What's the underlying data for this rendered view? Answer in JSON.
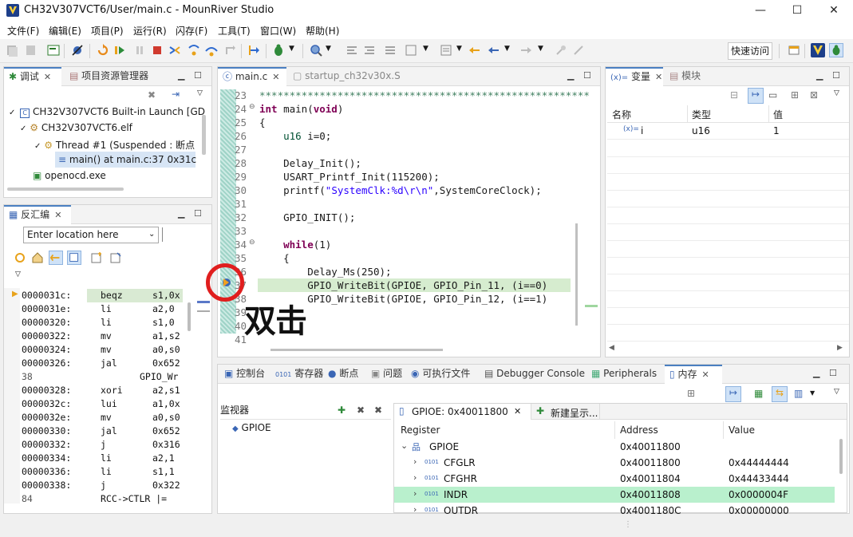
{
  "window": {
    "title": "CH32V307VCT6/User/main.c - MounRiver Studio",
    "minimize": "—",
    "maximize": "☐",
    "close": "✕"
  },
  "menu": [
    "文件(F)",
    "编辑(E)",
    "项目(P)",
    "运行(R)",
    "闪存(F)",
    "工具(T)",
    "窗口(W)",
    "帮助(H)"
  ],
  "toolbar": {
    "quick_access": "快速访问"
  },
  "debug_view": {
    "tab_debug": "调试",
    "tab_project": "项目资源管理器",
    "tree": [
      "CH32V307VCT6 Built-in Launch [GD",
      "CH32V307VCT6.elf",
      "Thread #1 (Suspended : 断点",
      "main() at main.c:37 0x31c",
      "openocd.exe"
    ]
  },
  "disasm_view": {
    "tab": "反汇编",
    "location_placeholder": "Enter location here",
    "rows": [
      {
        "addr": "0000031c:",
        "op": "beqz",
        "args": "s1,0x"
      },
      {
        "addr": "0000031e:",
        "op": "li",
        "args": "a2,0"
      },
      {
        "addr": "00000320:",
        "op": "li",
        "args": "s1,0"
      },
      {
        "addr": "00000322:",
        "op": "mv",
        "args": "a1,s2"
      },
      {
        "addr": "00000324:",
        "op": "mv",
        "args": "a0,s0"
      },
      {
        "addr": "00000326:",
        "op": "jal",
        "args": "0x652"
      },
      {
        "addr": "38",
        "op": "",
        "args": "GPIO_Wr"
      },
      {
        "addr": "00000328:",
        "op": "xori",
        "args": "a2,s1"
      },
      {
        "addr": "0000032c:",
        "op": "lui",
        "args": "a1,0x"
      },
      {
        "addr": "0000032e:",
        "op": "mv",
        "args": "a0,s0"
      },
      {
        "addr": "00000330:",
        "op": "jal",
        "args": "0x652"
      },
      {
        "addr": "00000332:",
        "op": "j",
        "args": "0x316"
      },
      {
        "addr": "00000334:",
        "op": "li",
        "args": "a2,1"
      },
      {
        "addr": "00000336:",
        "op": "li",
        "args": "s1,1"
      },
      {
        "addr": "00000338:",
        "op": "j",
        "args": "0x322"
      },
      {
        "addr": "84",
        "op": "RCC->CTLR |=",
        "args": ""
      }
    ]
  },
  "editor": {
    "tab_main": "main.c",
    "tab_startup": "startup_ch32v30x.S",
    "lines": [
      {
        "n": "23",
        "t": "*******************************************************"
      },
      {
        "n": "24",
        "t": "int main(void)"
      },
      {
        "n": "25",
        "t": "{"
      },
      {
        "n": "26",
        "t": "    u16 i=0;"
      },
      {
        "n": "27",
        "t": ""
      },
      {
        "n": "28",
        "t": "    Delay_Init();"
      },
      {
        "n": "29",
        "t": "    USART_Printf_Init(115200);"
      },
      {
        "n": "30",
        "t": "    printf(\"SystemClk:%d\\r\\n\",SystemCoreClock);"
      },
      {
        "n": "31",
        "t": ""
      },
      {
        "n": "32",
        "t": "    GPIO_INIT();"
      },
      {
        "n": "33",
        "t": ""
      },
      {
        "n": "34",
        "t": "    while(1)"
      },
      {
        "n": "35",
        "t": "    {"
      },
      {
        "n": "36",
        "t": "        Delay_Ms(250);"
      },
      {
        "n": "37",
        "t": "        GPIO_WriteBit(GPIOE, GPIO_Pin_11, (i==0)"
      },
      {
        "n": "38",
        "t": "        GPIO_WriteBit(GPIOE, GPIO_Pin_12, (i==1)"
      },
      {
        "n": "39",
        "t": ""
      },
      {
        "n": "40",
        "t": ""
      },
      {
        "n": "41",
        "t": ""
      }
    ],
    "annotation": "双击"
  },
  "variables": {
    "tab_vars": "变量",
    "tab_modules": "模块",
    "columns": [
      "名称",
      "类型",
      "值"
    ],
    "rows": [
      {
        "name": "i",
        "type": "u16",
        "value": "1"
      }
    ]
  },
  "bottom": {
    "tabs": [
      "控制台",
      "寄存器",
      "断点",
      "问题",
      "可执行文件",
      "Debugger Console",
      "Peripherals",
      "内存"
    ],
    "monitors_label": "监视器",
    "monitor_item": "GPIOE",
    "rendering_tab": "GPIOE: 0x40011800",
    "new_rendering": "新建呈示...",
    "columns": [
      "Register",
      "Address",
      "Value"
    ],
    "rows": [
      {
        "name": "GPIOE",
        "addr": "0x40011800",
        "value": ""
      },
      {
        "name": "CFGLR",
        "addr": "0x40011800",
        "value": "0x44444444"
      },
      {
        "name": "CFGHR",
        "addr": "0x40011804",
        "value": "0x44433444"
      },
      {
        "name": "INDR",
        "addr": "0x40011808",
        "value": "0x0000004F"
      },
      {
        "name": "OUTDR",
        "addr": "0x4001180C",
        "value": "0x00000000"
      }
    ]
  }
}
